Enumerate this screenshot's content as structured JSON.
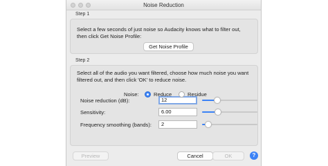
{
  "window": {
    "title": "Noise Reduction"
  },
  "step1": {
    "label": "Step 1",
    "description": "Select a few seconds of just noise so Audacity knows what to filter out, then click Get Noise Profile:",
    "button_label": "Get Noise Profile"
  },
  "step2": {
    "label": "Step 2",
    "description": "Select all of the audio you want filtered, choose how much noise you want filtered out, and then click 'OK' to reduce noise.",
    "fields": [
      {
        "label": "Noise reduction (dB):",
        "value": "12",
        "slider_fraction": 0.24
      },
      {
        "label": "Sensitivity:",
        "value": "6.00",
        "slider_fraction": 0.25
      },
      {
        "label": "Frequency smoothing (bands):",
        "value": "2",
        "slider_fraction": 0.06
      }
    ],
    "noise": {
      "label": "Noise:",
      "options": [
        {
          "label": "Reduce",
          "selected": true
        },
        {
          "label": "Residue",
          "selected": false
        }
      ]
    }
  },
  "footer": {
    "preview_label": "Preview",
    "cancel_label": "Cancel",
    "ok_label": "OK",
    "help_label": "?"
  },
  "colors": {
    "accent": "#3b82f6",
    "focus_ring": "#7fa7e6",
    "background": "#ececec"
  }
}
